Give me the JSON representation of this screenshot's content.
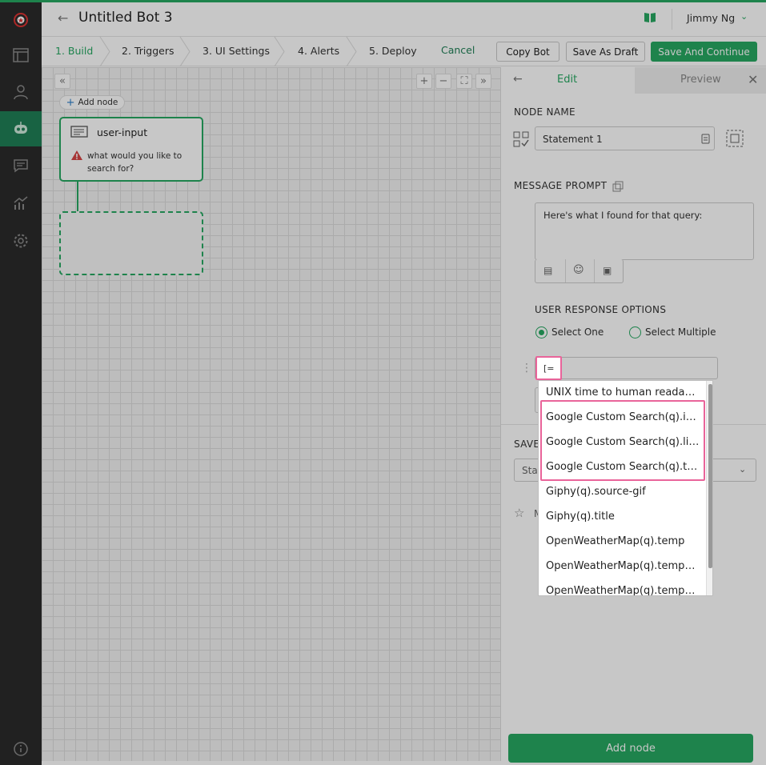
{
  "header": {
    "title": "Untitled Bot 3",
    "user": "Jimmy Ng"
  },
  "steps": [
    {
      "label": "1. Build",
      "active": true
    },
    {
      "label": "2. Triggers",
      "active": false
    },
    {
      "label": "3. UI Settings",
      "active": false
    },
    {
      "label": "4. Alerts",
      "active": false
    },
    {
      "label": "5. Deploy",
      "active": false
    }
  ],
  "actions": {
    "cancel": "Cancel",
    "copy_bot": "Copy Bot",
    "save_draft": "Save As Draft",
    "save_continue": "Save And Continue"
  },
  "canvas": {
    "add_node": "Add node",
    "node": {
      "title": "user-input",
      "message": "what would you like to search for?"
    }
  },
  "panel": {
    "tab_edit": "Edit",
    "tab_preview": "Preview",
    "node_name_label": "NODE NAME",
    "node_name_value": "Statement 1",
    "message_prompt_label": "MESSAGE PROMPT",
    "message_prompt_value": "Here's what I found for that query:",
    "user_response_label": "USER RESPONSE OPTIONS",
    "select_one": "Select One",
    "select_multiple": "Select Multiple",
    "save_label_partial": "SAVE",
    "select_partial": "Star",
    "row_partial": "M",
    "add_node_button": "Add node",
    "response_input_value": "[="
  },
  "dropdown": {
    "items": [
      "UNIX time to human readable",
      "Google Custom Search(q).items",
      "Google Custom Search(q).link",
      "Google Custom Search(q).title",
      "Giphy(q).source-gif",
      "Giphy(q).title",
      "OpenWeatherMap(q).temp",
      "OpenWeatherMap(q).temp_min",
      "OpenWeatherMap(q).temp_max"
    ]
  },
  "colors": {
    "accent": "#27a862",
    "sidebar": "#2b2b2b",
    "highlight": "#e9649a"
  }
}
